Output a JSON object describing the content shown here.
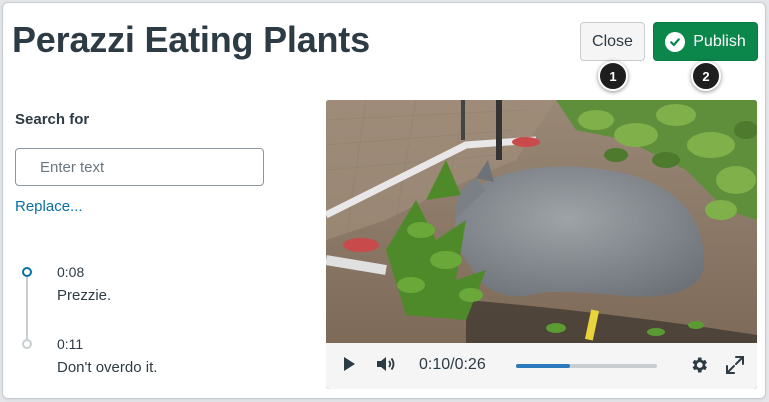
{
  "header": {
    "title": "Perazzi Eating Plants",
    "close_label": "Close",
    "publish_label": "Publish"
  },
  "callouts": {
    "one": "1",
    "two": "2"
  },
  "search": {
    "label": "Search for",
    "placeholder": "Enter text",
    "value": "",
    "replace_label": "Replace..."
  },
  "captions": [
    {
      "time": "0:08",
      "text": "Prezzie.",
      "active": true
    },
    {
      "time": "0:11",
      "text": "Don't overdo it.",
      "active": false
    }
  ],
  "player": {
    "time_display": "0:10/0:26",
    "progress_fraction": 0.385
  },
  "icons": {
    "publish": "check-circle-icon",
    "play": "play-icon",
    "volume": "volume-icon",
    "settings": "gear-icon",
    "fullscreen": "expand-icon"
  },
  "colors": {
    "primary_text": "#2d3b45",
    "link": "#0770a3",
    "publish_green": "#0b874b",
    "progress_blue": "#2b7abc"
  }
}
